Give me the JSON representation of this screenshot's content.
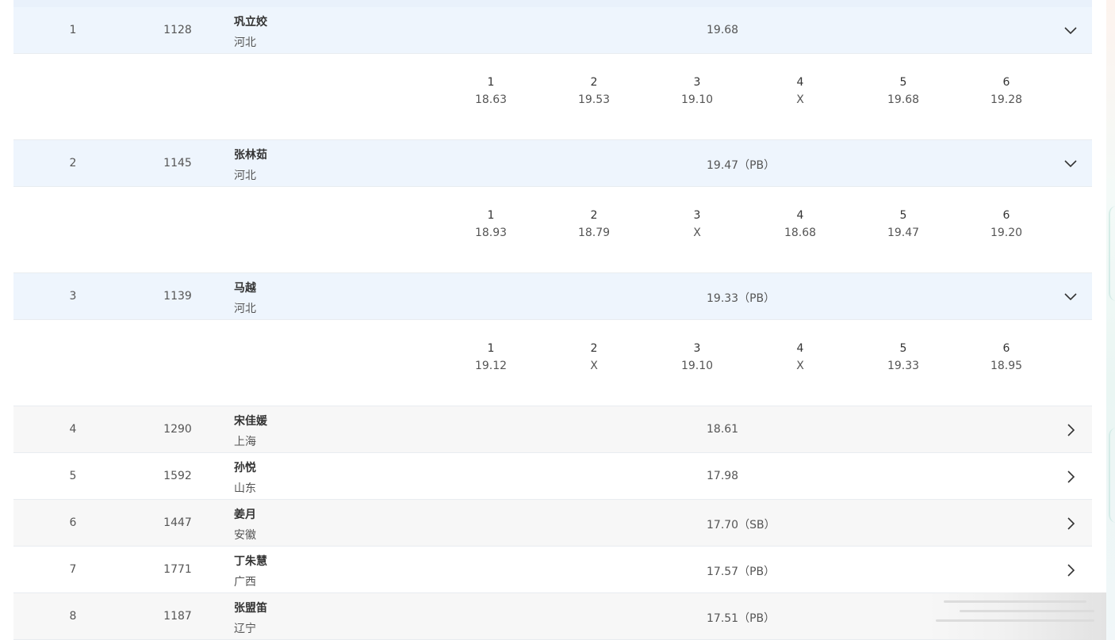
{
  "accent": "#eef5fd",
  "rows": [
    {
      "rank": "1",
      "bib": "1128",
      "name": "巩立姣",
      "team": "河北",
      "result": "19.68",
      "attempts": [
        {
          "n": "1",
          "v": "18.63"
        },
        {
          "n": "2",
          "v": "19.53"
        },
        {
          "n": "3",
          "v": "19.10"
        },
        {
          "n": "4",
          "v": "X"
        },
        {
          "n": "5",
          "v": "19.68"
        },
        {
          "n": "6",
          "v": "19.28"
        }
      ]
    },
    {
      "rank": "2",
      "bib": "1145",
      "name": "张林茹",
      "team": "河北",
      "result": "19.47（PB）",
      "attempts": [
        {
          "n": "1",
          "v": "18.93"
        },
        {
          "n": "2",
          "v": "18.79"
        },
        {
          "n": "3",
          "v": "X"
        },
        {
          "n": "4",
          "v": "18.68"
        },
        {
          "n": "5",
          "v": "19.47"
        },
        {
          "n": "6",
          "v": "19.20"
        }
      ]
    },
    {
      "rank": "3",
      "bib": "1139",
      "name": "马越",
      "team": "河北",
      "result": "19.33（PB）",
      "attempts": [
        {
          "n": "1",
          "v": "19.12"
        },
        {
          "n": "2",
          "v": "X"
        },
        {
          "n": "3",
          "v": "19.10"
        },
        {
          "n": "4",
          "v": "X"
        },
        {
          "n": "5",
          "v": "19.33"
        },
        {
          "n": "6",
          "v": "18.95"
        }
      ]
    },
    {
      "rank": "4",
      "bib": "1290",
      "name": "宋佳媛",
      "team": "上海",
      "result": "18.61"
    },
    {
      "rank": "5",
      "bib": "1592",
      "name": "孙悦",
      "team": "山东",
      "result": "17.98"
    },
    {
      "rank": "6",
      "bib": "1447",
      "name": "姜月",
      "team": "安徽",
      "result": "17.70（SB）"
    },
    {
      "rank": "7",
      "bib": "1771",
      "name": "丁朱慧",
      "team": "广西",
      "result": "17.57（PB）"
    },
    {
      "rank": "8",
      "bib": "1187",
      "name": "张盟笛",
      "team": "辽宁",
      "result": "17.51（PB）"
    }
  ]
}
